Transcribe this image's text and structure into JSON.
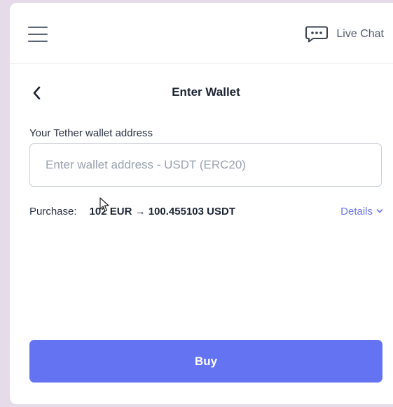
{
  "topbar": {
    "menu_icon": "hamburger-menu-icon",
    "chat_icon": "chat-bubble-icon",
    "live_chat_label": "Live Chat"
  },
  "header": {
    "back_icon": "chevron-left-icon",
    "title": "Enter Wallet"
  },
  "wallet": {
    "label": "Your Tether wallet address",
    "value": "",
    "placeholder": "Enter wallet address - USDT (ERC20)"
  },
  "purchase": {
    "label": "Purchase:",
    "amount": "102 EUR → 100.455103 USDT",
    "details_label": "Details",
    "details_icon": "chevron-down-icon"
  },
  "buy": {
    "label": "Buy"
  },
  "colors": {
    "accent": "#6473f2",
    "link": "#6b77e8",
    "title": "#1b2333",
    "muted_text": "#515a6b",
    "background": "#e6dbe9"
  }
}
